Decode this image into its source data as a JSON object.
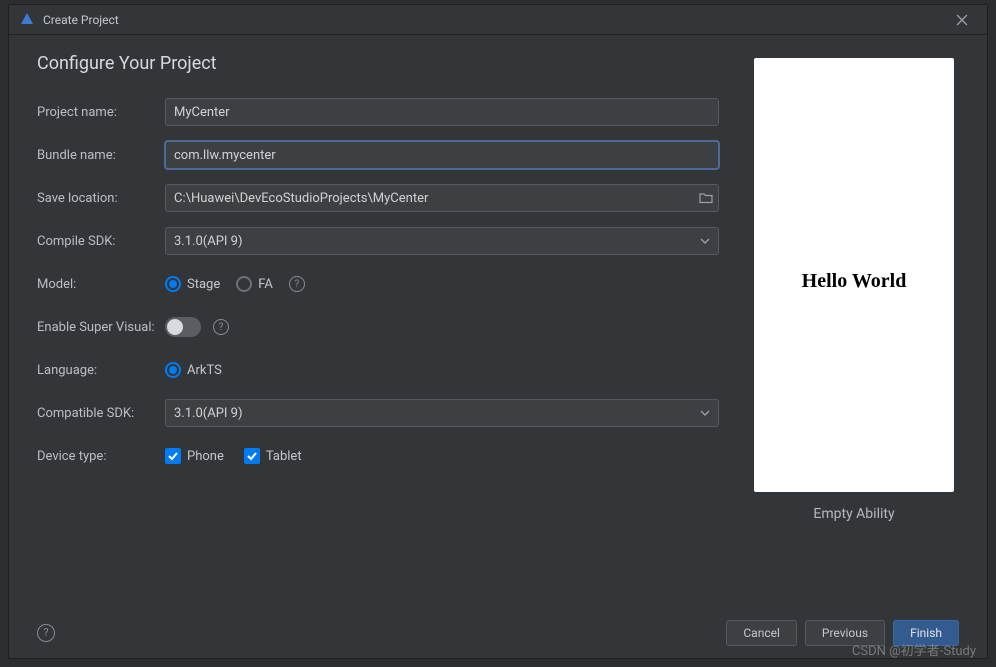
{
  "titlebar": {
    "title": "Create Project"
  },
  "page": {
    "heading": "Configure Your Project"
  },
  "form": {
    "project_name": {
      "label": "Project name:",
      "value": "MyCenter"
    },
    "bundle_name": {
      "label": "Bundle name:",
      "value": "com.llw.mycenter"
    },
    "save_location": {
      "label": "Save location:",
      "value": "C:\\Huawei\\DevEcoStudioProjects\\MyCenter"
    },
    "compile_sdk": {
      "label": "Compile SDK:",
      "value": "3.1.0(API 9)"
    },
    "model": {
      "label": "Model:",
      "options": [
        "Stage",
        "FA"
      ],
      "selected": "Stage"
    },
    "enable_super_visual": {
      "label": "Enable Super Visual:",
      "value": false
    },
    "language": {
      "label": "Language:",
      "options": [
        "ArkTS"
      ],
      "selected": "ArkTS"
    },
    "compatible_sdk": {
      "label": "Compatible SDK:",
      "value": "3.1.0(API 9)"
    },
    "device_type": {
      "label": "Device type:",
      "options": [
        {
          "label": "Phone",
          "checked": true
        },
        {
          "label": "Tablet",
          "checked": true
        }
      ]
    }
  },
  "preview": {
    "text": "Hello World",
    "caption": "Empty Ability"
  },
  "footer": {
    "cancel": "Cancel",
    "previous": "Previous",
    "finish": "Finish"
  },
  "watermark": "CSDN @初学者-Study"
}
